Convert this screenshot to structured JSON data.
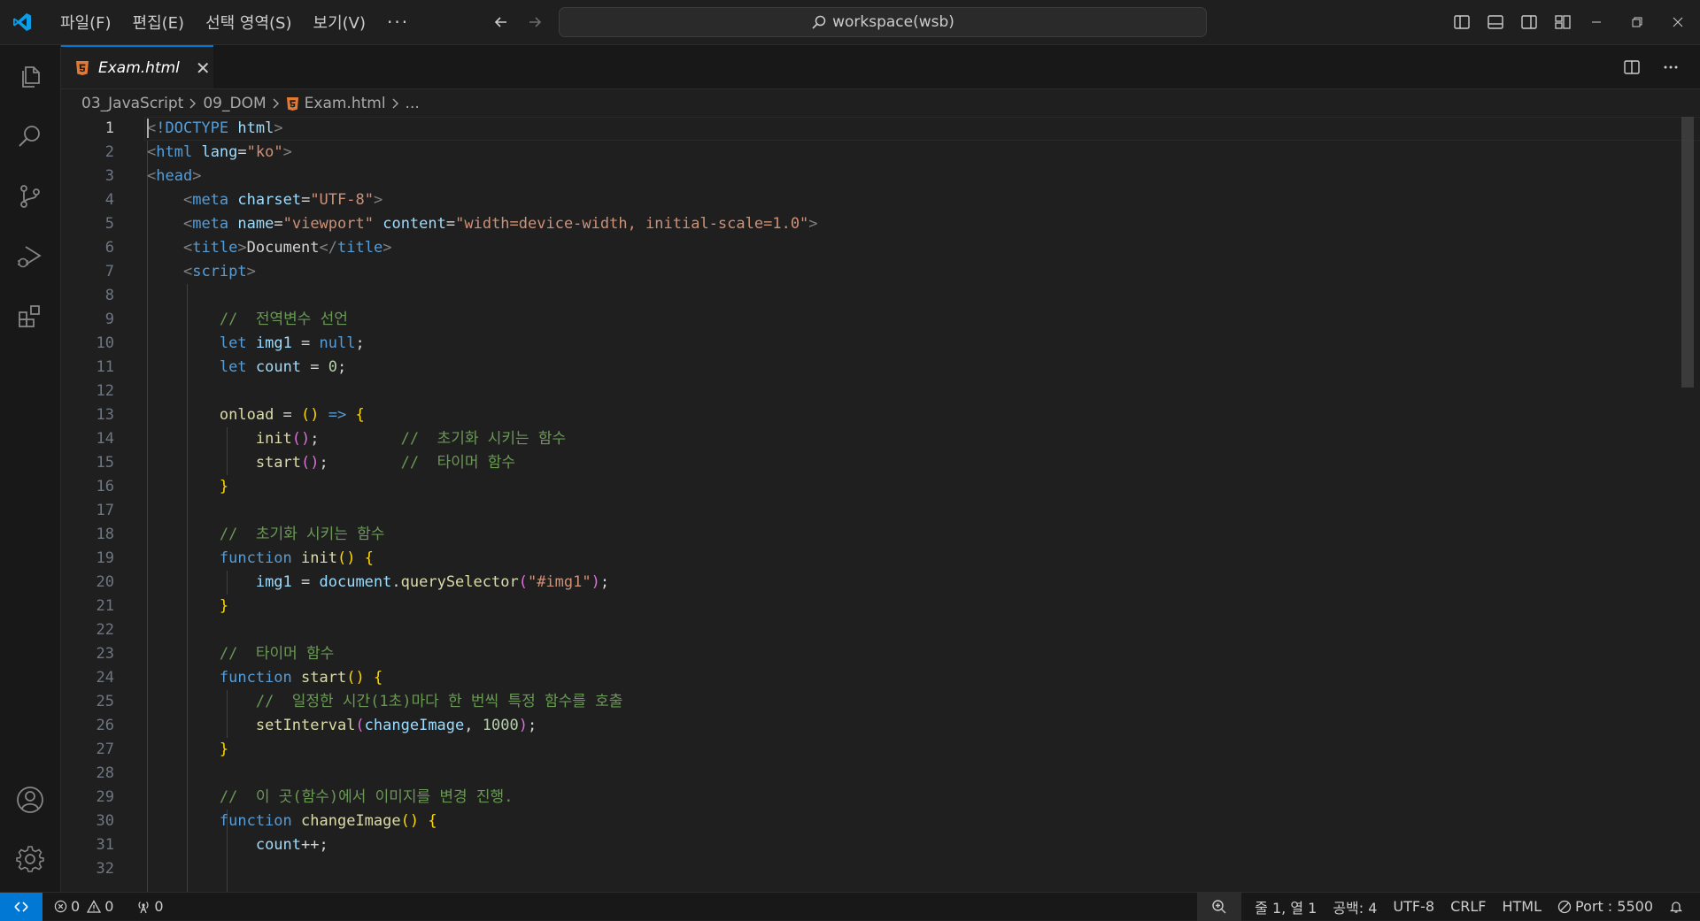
{
  "titlebar": {
    "menu": [
      "파일(F)",
      "편집(E)",
      "선택 영역(S)",
      "보기(V)"
    ],
    "more": "···",
    "search_text": "workspace(wsb)"
  },
  "tab": {
    "label": "Exam.html",
    "close": "✕",
    "active": true
  },
  "breadcrumb": [
    "03_JavaScript",
    "09_DOM",
    "Exam.html",
    "..."
  ],
  "editor": {
    "current_line": 1,
    "lines": [
      [
        [
          "p",
          "<"
        ],
        [
          "t",
          "!DOCTYPE"
        ],
        [
          "w",
          " "
        ],
        [
          "a",
          "html"
        ],
        [
          "p",
          ">"
        ]
      ],
      [
        [
          "p",
          "<"
        ],
        [
          "t",
          "html"
        ],
        [
          "w",
          " "
        ],
        [
          "a",
          "lang"
        ],
        [
          "w",
          "="
        ],
        [
          "s",
          "\"ko\""
        ],
        [
          "p",
          ">"
        ]
      ],
      [
        [
          "p",
          "<"
        ],
        [
          "t",
          "head"
        ],
        [
          "p",
          ">"
        ]
      ],
      [
        [
          "w",
          "    "
        ],
        [
          "p",
          "<"
        ],
        [
          "t",
          "meta"
        ],
        [
          "w",
          " "
        ],
        [
          "a",
          "charset"
        ],
        [
          "w",
          "="
        ],
        [
          "s",
          "\"UTF-8\""
        ],
        [
          "p",
          ">"
        ]
      ],
      [
        [
          "w",
          "    "
        ],
        [
          "p",
          "<"
        ],
        [
          "t",
          "meta"
        ],
        [
          "w",
          " "
        ],
        [
          "a",
          "name"
        ],
        [
          "w",
          "="
        ],
        [
          "s",
          "\"viewport\""
        ],
        [
          "w",
          " "
        ],
        [
          "a",
          "content"
        ],
        [
          "w",
          "="
        ],
        [
          "s",
          "\"width=device-width, initial-scale=1.0\""
        ],
        [
          "p",
          ">"
        ]
      ],
      [
        [
          "w",
          "    "
        ],
        [
          "p",
          "<"
        ],
        [
          "t",
          "title"
        ],
        [
          "p",
          ">"
        ],
        [
          "w",
          "Document"
        ],
        [
          "p",
          "</"
        ],
        [
          "t",
          "title"
        ],
        [
          "p",
          ">"
        ]
      ],
      [
        [
          "w",
          "    "
        ],
        [
          "p",
          "<"
        ],
        [
          "t",
          "script"
        ],
        [
          "p",
          ">"
        ]
      ],
      [],
      [
        [
          "w",
          "        "
        ],
        [
          "c",
          "//  전역변수 선언"
        ]
      ],
      [
        [
          "w",
          "        "
        ],
        [
          "t",
          "let"
        ],
        [
          "w",
          " "
        ],
        [
          "a",
          "img1"
        ],
        [
          "w",
          " = "
        ],
        [
          "t",
          "null"
        ],
        [
          "w",
          ";"
        ]
      ],
      [
        [
          "w",
          "        "
        ],
        [
          "t",
          "let"
        ],
        [
          "w",
          " "
        ],
        [
          "a",
          "count"
        ],
        [
          "w",
          " = "
        ],
        [
          "n",
          "0"
        ],
        [
          "w",
          ";"
        ]
      ],
      [],
      [
        [
          "w",
          "        "
        ],
        [
          "f",
          "onload"
        ],
        [
          "w",
          " = "
        ],
        [
          "y",
          "()"
        ],
        [
          "w",
          " "
        ],
        [
          "t",
          "=>"
        ],
        [
          "w",
          " "
        ],
        [
          "y",
          "{"
        ]
      ],
      [
        [
          "w",
          "            "
        ],
        [
          "f",
          "init"
        ],
        [
          "m",
          "()"
        ],
        [
          "w",
          ";         "
        ],
        [
          "c",
          "//  초기화 시키는 함수"
        ]
      ],
      [
        [
          "w",
          "            "
        ],
        [
          "f",
          "start"
        ],
        [
          "m",
          "()"
        ],
        [
          "w",
          ";        "
        ],
        [
          "c",
          "//  타이머 함수"
        ]
      ],
      [
        [
          "w",
          "        "
        ],
        [
          "y",
          "}"
        ]
      ],
      [],
      [
        [
          "w",
          "        "
        ],
        [
          "c",
          "//  초기화 시키는 함수"
        ]
      ],
      [
        [
          "w",
          "        "
        ],
        [
          "t",
          "function"
        ],
        [
          "w",
          " "
        ],
        [
          "f",
          "init"
        ],
        [
          "y",
          "()"
        ],
        [
          "w",
          " "
        ],
        [
          "y",
          "{"
        ]
      ],
      [
        [
          "w",
          "            "
        ],
        [
          "a",
          "img1"
        ],
        [
          "w",
          " = "
        ],
        [
          "a",
          "document"
        ],
        [
          "w",
          "."
        ],
        [
          "f",
          "querySelector"
        ],
        [
          "m",
          "("
        ],
        [
          "s",
          "\"#img1\""
        ],
        [
          "m",
          ")"
        ],
        [
          "w",
          ";"
        ]
      ],
      [
        [
          "w",
          "        "
        ],
        [
          "y",
          "}"
        ]
      ],
      [],
      [
        [
          "w",
          "        "
        ],
        [
          "c",
          "//  타이머 함수"
        ]
      ],
      [
        [
          "w",
          "        "
        ],
        [
          "t",
          "function"
        ],
        [
          "w",
          " "
        ],
        [
          "f",
          "start"
        ],
        [
          "y",
          "()"
        ],
        [
          "w",
          " "
        ],
        [
          "y",
          "{"
        ]
      ],
      [
        [
          "w",
          "            "
        ],
        [
          "c",
          "//  일정한 시간(1초)마다 한 번씩 특정 함수를 호출"
        ]
      ],
      [
        [
          "w",
          "            "
        ],
        [
          "f",
          "setInterval"
        ],
        [
          "m",
          "("
        ],
        [
          "a",
          "changeImage"
        ],
        [
          "w",
          ", "
        ],
        [
          "n",
          "1000"
        ],
        [
          "m",
          ")"
        ],
        [
          "w",
          ";"
        ]
      ],
      [
        [
          "w",
          "        "
        ],
        [
          "y",
          "}"
        ]
      ],
      [],
      [
        [
          "w",
          "        "
        ],
        [
          "c",
          "//  이 곳(함수)에서 이미지를 변경 진행."
        ]
      ],
      [
        [
          "w",
          "        "
        ],
        [
          "t",
          "function"
        ],
        [
          "w",
          " "
        ],
        [
          "f",
          "changeImage"
        ],
        [
          "y",
          "()"
        ],
        [
          "w",
          " "
        ],
        [
          "y",
          "{"
        ]
      ],
      [
        [
          "w",
          "            "
        ],
        [
          "a",
          "count"
        ],
        [
          "w",
          "++;"
        ]
      ],
      []
    ]
  },
  "statusbar": {
    "errors": "0",
    "warnings": "0",
    "ports_count": "0",
    "position": "줄 1, 열 1",
    "indent": "공백: 4",
    "encoding": "UTF-8",
    "eol": "CRLF",
    "language": "HTML",
    "port": "Port : 5500"
  },
  "colors": {
    "accent": "#0078d4",
    "background": "#1f1f1f",
    "html_file_icon": "#e37933"
  }
}
